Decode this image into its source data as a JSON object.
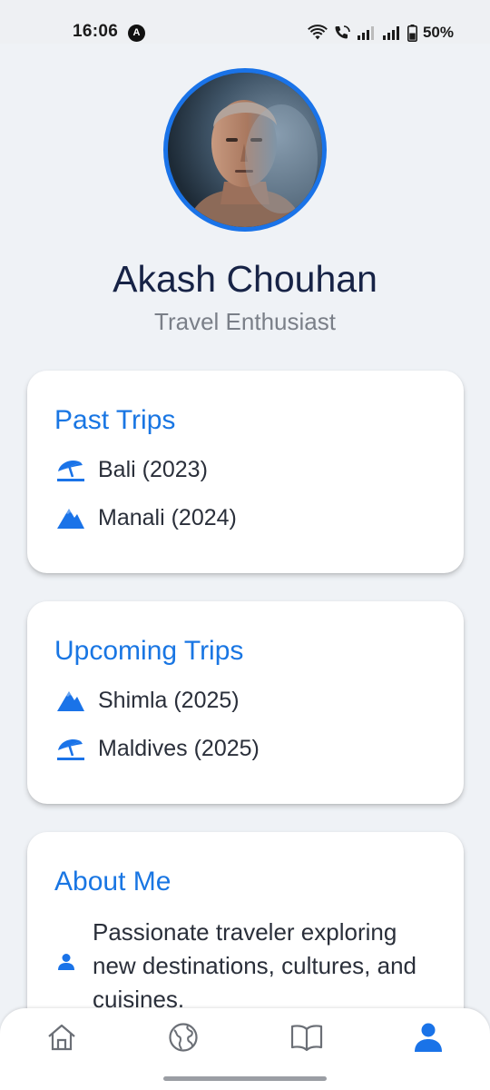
{
  "status_bar": {
    "time": "16:06",
    "notification_badge": "A",
    "battery": "50%"
  },
  "profile": {
    "name": "Akash Chouhan",
    "subtitle": "Travel Enthusiast"
  },
  "past_trips": {
    "title": "Past Trips",
    "items": [
      {
        "icon": "beach-umbrella-icon",
        "label": "Bali (2023)"
      },
      {
        "icon": "mountain-icon",
        "label": "Manali (2024)"
      }
    ]
  },
  "upcoming_trips": {
    "title": "Upcoming Trips",
    "items": [
      {
        "icon": "mountain-icon",
        "label": "Shimla (2025)"
      },
      {
        "icon": "beach-umbrella-icon",
        "label": "Maldives (2025)"
      }
    ]
  },
  "about": {
    "title": "About Me",
    "icon": "person-icon",
    "text": "Passionate traveler exploring new destinations, cultures, and cuisines."
  },
  "bottom_nav": {
    "items": [
      {
        "icon": "home-icon",
        "active": false
      },
      {
        "icon": "globe-icon",
        "active": false
      },
      {
        "icon": "book-icon",
        "active": false
      },
      {
        "icon": "person-icon",
        "active": true
      }
    ]
  },
  "colors": {
    "accent": "#1a73e8",
    "background": "#eff2f6",
    "card": "#ffffff",
    "inactive_icon": "#6b6f76"
  }
}
